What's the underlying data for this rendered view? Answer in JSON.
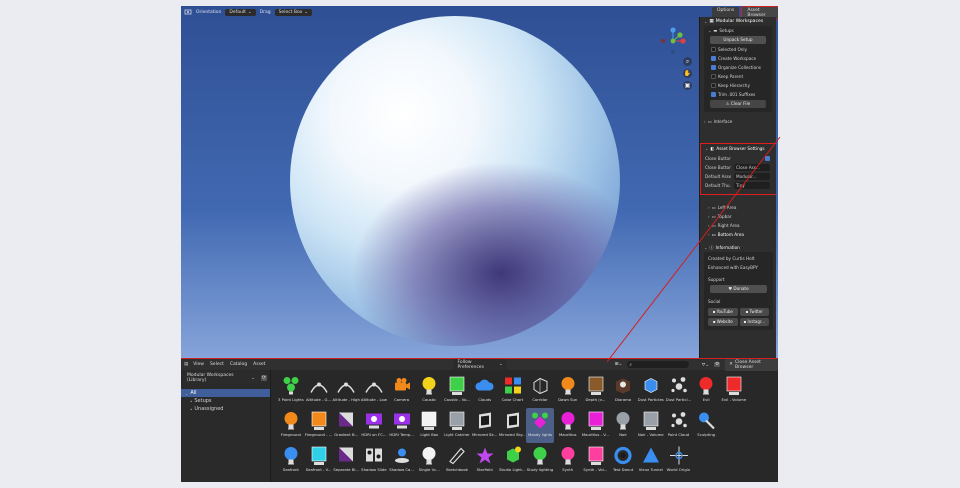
{
  "viewport": {
    "header": {
      "orientation_label": "Orientation",
      "orientation_value": "Default",
      "drag_label": "Drag",
      "drag_value": "Select Box"
    },
    "top_right": {
      "options": "Options",
      "asset_browser": "Asset Browser"
    }
  },
  "npanel": {
    "title": "Modular Workspaces",
    "setup": {
      "title": "Setups",
      "unpack_button": "Unpack Setup",
      "options": [
        {
          "label": "Selected Only",
          "checked": false
        },
        {
          "label": "Create Workspace",
          "checked": true
        },
        {
          "label": "Organize Collections",
          "checked": true
        },
        {
          "label": "Keep Parent",
          "checked": false
        },
        {
          "label": "Keep Hierarchy",
          "checked": false
        },
        {
          "label": "Trim .001 Suffixes",
          "checked": true
        }
      ],
      "clear_button": "Clear File"
    },
    "interface": "Interface",
    "asset_settings": {
      "title": "Asset Browser Settings",
      "close_button_label": "Close Button",
      "close_button_checked": true,
      "rows": [
        {
          "key": "Close Button...",
          "value": "Close Ass..."
        },
        {
          "key": "Default Asse...",
          "value": "Modular..."
        },
        {
          "key": "Default Thu...",
          "value": "Tiny"
        }
      ]
    },
    "areas": [
      "Left Area",
      "Topbar",
      "Right Area",
      "Bottom Area"
    ],
    "information": {
      "title": "Information",
      "created_by": "Created by Curtis Holt",
      "enhanced": "Enhanced with EasyBPY",
      "support_label": "Support",
      "donate": "Donate",
      "social_label": "Social",
      "social": [
        "YouTube",
        "Twitter",
        "Website",
        "Instagr..."
      ]
    }
  },
  "browser": {
    "menus": [
      "View",
      "Select",
      "Catalog",
      "Asset"
    ],
    "library": "Modular Workspaces (Library)",
    "filter": "Follow Preferences",
    "close_button": "Close Asset Browser",
    "tree": [
      {
        "label": "All",
        "selected": true
      },
      {
        "label": "Setups",
        "selected": false
      },
      {
        "label": "Unassigned",
        "selected": false
      }
    ],
    "assets": [
      {
        "label": "3 Point Lights",
        "icon": "three-lights",
        "sel": false
      },
      {
        "label": "Altitude - G...",
        "icon": "arc",
        "sel": false
      },
      {
        "label": "Altitude - High",
        "icon": "arc",
        "sel": false
      },
      {
        "label": "Altitude - Low",
        "icon": "arc",
        "sel": false
      },
      {
        "label": "Camera",
        "icon": "camera",
        "sel": false
      },
      {
        "label": "Caustic",
        "icon": "bulb-yellow",
        "sel": false
      },
      {
        "label": "Caustic - Vo...",
        "icon": "square-green",
        "sel": false
      },
      {
        "label": "Clouds",
        "icon": "cloud",
        "sel": false
      },
      {
        "label": "Color Chart",
        "icon": "color-chart",
        "sel": false
      },
      {
        "label": "Corridor",
        "icon": "cube-wire",
        "sel": false
      },
      {
        "label": "Dawn Sun",
        "icon": "bulb-orange",
        "sel": false
      },
      {
        "label": "Depth (v...",
        "icon": "square-brown",
        "sel": false
      },
      {
        "label": "Diorama",
        "icon": "diorama",
        "sel": false
      },
      {
        "label": "Dust Particles",
        "icon": "cube-blue",
        "sel": false
      },
      {
        "label": "Dust Particl...",
        "icon": "particles",
        "sel": false
      },
      {
        "label": "Evil",
        "icon": "bulb-red",
        "sel": false
      },
      {
        "label": "Evil - Volume",
        "icon": "square-red",
        "sel": false
      },
      {
        "label": "",
        "icon": "none",
        "sel": false
      },
      {
        "label": "Fireground",
        "icon": "bulb-orange",
        "sel": false
      },
      {
        "label": "Fireground - ...",
        "icon": "square-orange",
        "sel": false
      },
      {
        "label": "Gradient B...",
        "icon": "gradient",
        "sel": false
      },
      {
        "label": "HDRI on FC...",
        "icon": "hdri",
        "sel": false
      },
      {
        "label": "HDRI Temp...",
        "icon": "hdri",
        "sel": false
      },
      {
        "label": "Light Box",
        "icon": "square-white",
        "sel": false
      },
      {
        "label": "Light Catcher",
        "icon": "square-gray",
        "sel": false
      },
      {
        "label": "Mirrored Sk...",
        "icon": "mirror",
        "sel": false
      },
      {
        "label": "Mirrored Sky...",
        "icon": "mirror",
        "sel": false
      },
      {
        "label": "Moody lights",
        "icon": "diamond-pink",
        "sel": true
      },
      {
        "label": "Mauritius",
        "icon": "bulb-magenta",
        "sel": false
      },
      {
        "label": "Mauritius - V...",
        "icon": "square-magenta",
        "sel": false
      },
      {
        "label": "Noir",
        "icon": "bulb-gray",
        "sel": false
      },
      {
        "label": "Noir - Volume",
        "icon": "square-gray",
        "sel": false
      },
      {
        "label": "Point Cloud",
        "icon": "particles",
        "sel": false
      },
      {
        "label": "Sculpting",
        "icon": "sculpt",
        "sel": false
      },
      {
        "label": "",
        "icon": "none",
        "sel": false
      },
      {
        "label": "",
        "icon": "none",
        "sel": false
      },
      {
        "label": "Seafront",
        "icon": "bulb-blue",
        "sel": false
      },
      {
        "label": "Seafront - V...",
        "icon": "square-cyan",
        "sel": false
      },
      {
        "label": "Separate Bl...",
        "icon": "gradient",
        "sel": false
      },
      {
        "label": "Shadow Slide",
        "icon": "slide",
        "sel": false
      },
      {
        "label": "Shadow Ca...",
        "icon": "shadow-cam",
        "sel": false
      },
      {
        "label": "Single Vc...",
        "icon": "bulb-white",
        "sel": false
      },
      {
        "label": "Sketchbook",
        "icon": "sketch",
        "sel": false
      },
      {
        "label": "Starfield",
        "icon": "star",
        "sel": false
      },
      {
        "label": "Studio Light...",
        "icon": "cube-green",
        "sel": false
      },
      {
        "label": "Study lighting",
        "icon": "bulb-green",
        "sel": false
      },
      {
        "label": "Synth",
        "icon": "bulb-pink",
        "sel": false
      },
      {
        "label": "Synth - Vol...",
        "icon": "square-pink",
        "sel": false
      },
      {
        "label": "Test Donut",
        "icon": "donut",
        "sel": false
      },
      {
        "label": "Vieux Tunnel",
        "icon": "triangle-blue",
        "sel": false
      },
      {
        "label": "World Origin",
        "icon": "crosshair",
        "sel": false
      }
    ]
  },
  "colors": {
    "highlight_red": "#d21f1f",
    "accent_blue": "#4a7cd6",
    "viewport_top": "#2f4f94",
    "viewport_bottom": "#86a4da"
  }
}
